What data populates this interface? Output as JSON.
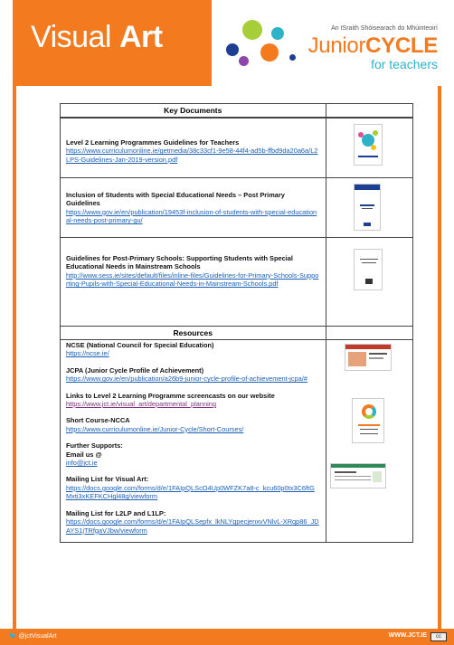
{
  "header": {
    "title_light": "Visual ",
    "title_bold": "Art",
    "brand_sub": "An tSraith Shóisearach do Mhúinteoirí",
    "brand_junior": "Junior",
    "brand_cycle": "CYCLE",
    "brand_teachers": "for teachers"
  },
  "key_documents": {
    "heading": "Key Documents",
    "items": [
      {
        "title": "Level 2 Learning Programmes Guidelines for Teachers",
        "link": "https://www.curriculumonline.ie/getmedia/38c33cf1-9e58-44f4-ad5b-ffbd9da20a6a/L2LPS-Guidelines-Jan-2019-version.pdf"
      },
      {
        "title": "Inclusion of Students with Special Educational Needs – Post Primary Guidelines",
        "link": "https://www.gov.ie/en/publication/19453f-inclusion-of-students-with-special-educational-needs-post-primary-gu/"
      },
      {
        "title": "Guidelines for Post-Primary Schools: Supporting Students with Special Educational Needs in Mainstream Schools",
        "link": "http://www.sess.ie/sites/default/files/inline-files/Guidelines-for-Primary-Schools-Supporting-Pupils-with-Special-Educational-Needs-in-Mainstream-Schools.pdf"
      }
    ]
  },
  "resources": {
    "heading": "Resources",
    "items": [
      {
        "title": "NCSE (National Council for Special Education)",
        "link": "https://ncse.ie/"
      },
      {
        "title": "JCPA (Junior Cycle Profile of Achievement)",
        "link": "https://www.gov.ie/en/publication/a26b9-junior-cycle-profile-of-achievement-jcpa/#"
      },
      {
        "title": "Links to Level 2 Learning Programme screencasts on our website",
        "link": "https://www.jct.ie/visual_art/departmental_planning"
      },
      {
        "title": "Short Course-NCCA",
        "link": "https://www.curriculumonline.ie/Junior-Cycle/Short-Courses/"
      },
      {
        "title": "Further Supports:",
        "subtitle": "Email us @",
        "link": "info@jct.ie"
      },
      {
        "title": "Mailing List for Visual Art:",
        "link": "https://docs.google.com/forms/d/e/1FAIpQLScO4Up0WFZK7a8-c_kcu60p0tx3C6ftGMxti3xKEFKCHgl48g/viewform"
      },
      {
        "title": "Mailing List for L2LP and L1LP:",
        "link": "https://docs.google.com/forms/d/e/1FAIpQLSepfx_lkNLYgpecjenxvVNlvL-XRqp86_JDAYS1jTRfgaVJbw/viewform"
      }
    ]
  },
  "footer": {
    "twitter": "🐦 @jctVisualArt",
    "website": "WWW.JCT.IE",
    "cc": "cc"
  },
  "colors": {
    "accent": "#f47a20",
    "link": "#1a5fb4",
    "teal": "#2eb2c8"
  }
}
